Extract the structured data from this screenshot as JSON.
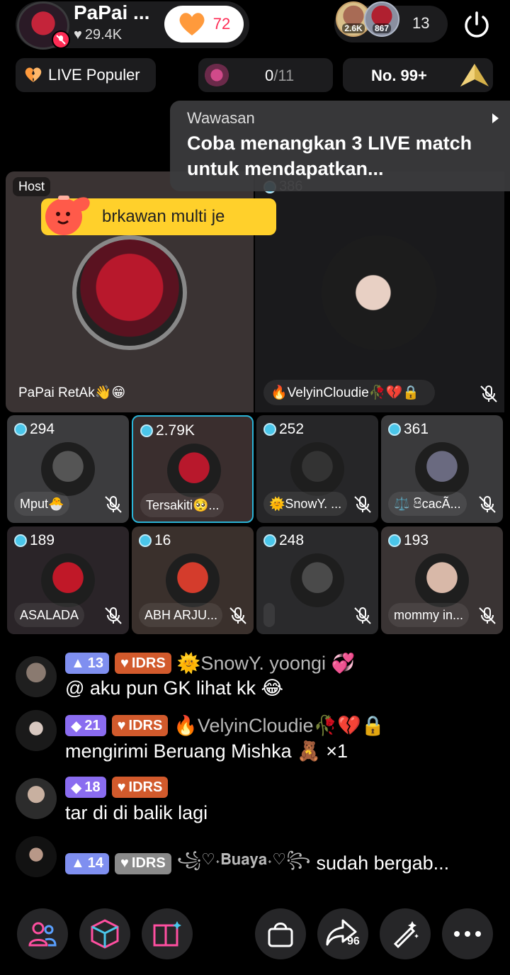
{
  "host": {
    "name": "PaPai ...",
    "likes": "29.4K",
    "follow_count": "72"
  },
  "viewers": {
    "badge1": "2.6K",
    "badge2": "867",
    "count": "13"
  },
  "row2": {
    "live_popular": "LIVE Populer",
    "match_progress": "0",
    "match_total": "/11",
    "rank": "No. 99+"
  },
  "insight": {
    "title": "Wawasan",
    "text": "Coba menangkan 3 LIVE match untuk mendapatkan..."
  },
  "big_tiles": {
    "host_tag": "Host",
    "banner_text": "brkawan multi je",
    "host_name": "PaPai RetAk👋😁",
    "guest_score": "386",
    "guest_name": "🔥VelyinCloudie🥀💔🔒"
  },
  "small_tiles": [
    {
      "score": "294",
      "name": "Mput🐣",
      "color": "#3c3c3e"
    },
    {
      "score": "2.79K",
      "name": "Tersakiti🥺...",
      "color": "#3a2e2e"
    },
    {
      "score": "252",
      "name": "🌞SnowY. ...",
      "color": "#262628"
    },
    {
      "score": "361",
      "name": "⚖️ පිcacÃ...",
      "color": "#3a3a3c"
    },
    {
      "score": "189",
      "name": "ASALADA",
      "color": "#2a2428"
    },
    {
      "score": "16",
      "name": "ABH ARJU...",
      "color": "#3a302c"
    },
    {
      "score": "248",
      "name": "",
      "color": "#2a2a2c"
    },
    {
      "score": "193",
      "name": "mommy in...",
      "color": "#3a3434"
    }
  ],
  "chat": [
    {
      "level": "13",
      "badge": "IDRS",
      "user": "🌞SnowY. yoongi 💞",
      "message": "@             aku pun GK lihat kk 😂"
    },
    {
      "level": "21",
      "badge": "IDRS",
      "user": "🔥VelyinCloudie🥀💔🔒",
      "message": "mengirimi              Beruang Mishka 🧸 ×1"
    },
    {
      "level": "18",
      "badge": "IDRS",
      "user": "",
      "message": "tar di di balik lagi"
    },
    {
      "level": "14",
      "badge": "IDRS",
      "user": "꧁♡˖𝐁𝐮𝐚𝐲𝐚˖♡꧂",
      "message": "sudah bergab..."
    }
  ],
  "bottom": {
    "share_count": "96"
  }
}
